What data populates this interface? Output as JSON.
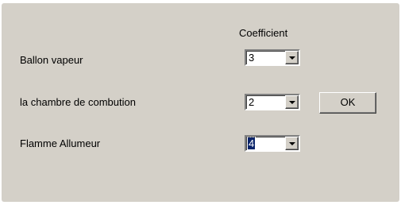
{
  "dialog": {
    "column_header": "Coefficient",
    "rows": [
      {
        "label": "Ballon vapeur",
        "coefficient": "3"
      },
      {
        "label": "la chambre de combution",
        "coefficient": "2"
      },
      {
        "label": "Flamme Allumeur",
        "coefficient": "4"
      }
    ],
    "ok_label": "OK",
    "focused_row": 2
  },
  "icons": {
    "dropdown": "chevron-down-icon"
  },
  "colors": {
    "face": "#d4d0c8",
    "selection": "#0a246a"
  }
}
